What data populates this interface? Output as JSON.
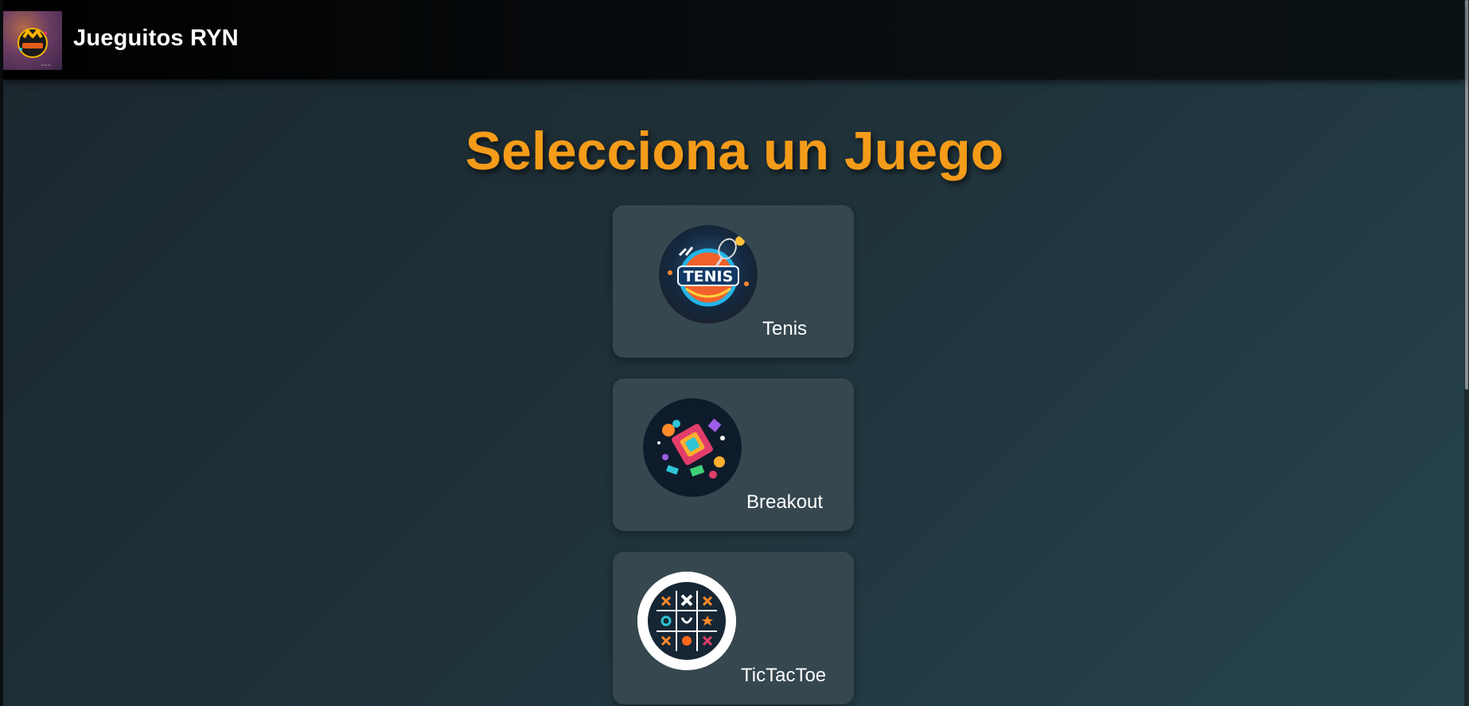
{
  "header": {
    "title": "Jueguitos RYN",
    "logo_icon": "gamepad-logo-icon"
  },
  "main": {
    "title": "Selecciona un Juego",
    "games": [
      {
        "label": "Tenis",
        "icon": "tennis-ball-racket-icon"
      },
      {
        "label": "Breakout",
        "icon": "colorful-blocks-icon"
      },
      {
        "label": "TicTacToe",
        "icon": "tic-tac-toe-grid-icon"
      }
    ]
  },
  "colors": {
    "accent": "#f49b1a",
    "card": "#36474f",
    "header": "#000000"
  }
}
